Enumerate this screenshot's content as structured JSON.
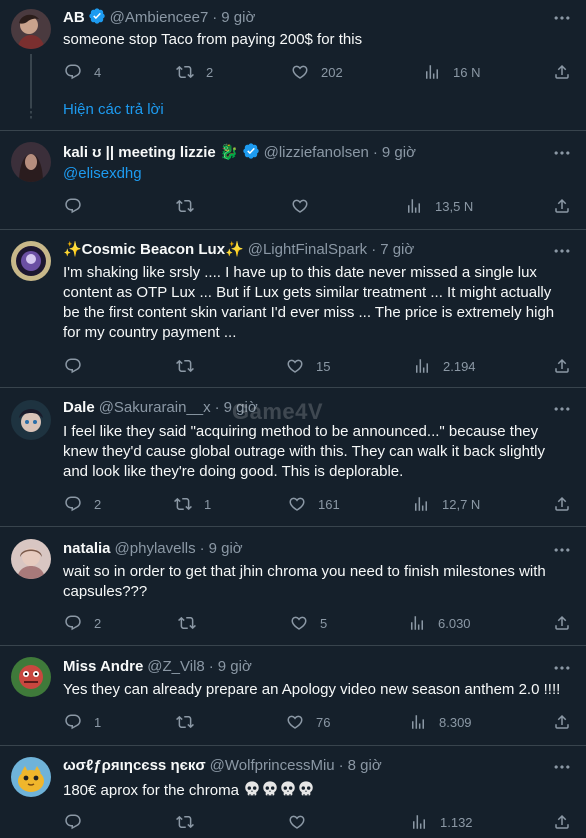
{
  "tweets": [
    {
      "name": "AB",
      "verified": true,
      "handle": "@Ambiencee7",
      "time": "9 giờ",
      "text": "someone stop Taco from paying 200$ for this",
      "replies": "4",
      "retweets": "2",
      "likes": "202",
      "views": "16 N",
      "show_replies": "Hiện các trả lời"
    },
    {
      "name": "kali ʊ || meeting lizzie 🐉",
      "verified": true,
      "handle": "@lizziefanolsen",
      "time": "9 giờ",
      "text": "@elisexdhg",
      "replies": "",
      "retweets": "",
      "likes": "",
      "views": "13,5 N"
    },
    {
      "name": "✨Cosmic Beacon Lux✨",
      "verified": false,
      "handle": "@LightFinalSpark",
      "time": "7 giờ",
      "text": "I'm shaking like srsly .... I have up to this date never missed a single lux content as OTP Lux ... But if Lux gets similar treatment ... It might actually be the first content skin variant I'd ever miss ... The price is extremely high for my country payment ...",
      "replies": "",
      "retweets": "",
      "likes": "15",
      "views": "2.194"
    },
    {
      "name": "Dale",
      "verified": false,
      "handle": "@Sakurarain__x",
      "time": "9 giờ",
      "text": "I feel like they said \"acquiring method to be announced...\" because they knew they'd cause global outrage with this. They can walk it back slightly and look like they're doing good. This is deplorable.",
      "replies": "2",
      "retweets": "1",
      "likes": "161",
      "views": "12,7 N",
      "watermark": "Game4V"
    },
    {
      "name": "natalia",
      "verified": false,
      "handle": "@phylavells",
      "time": "9 giờ",
      "text": "wait so in order to get that jhin chroma you need to finish milestones with capsules???",
      "replies": "2",
      "retweets": "",
      "likes": "5",
      "views": "6.030"
    },
    {
      "name": "Miss Andre",
      "verified": false,
      "handle": "@Z_Vil8",
      "time": "9 giờ",
      "text": "Yes they can already prepare an Apology video new season anthem 2.0 !!!!",
      "replies": "1",
      "retweets": "",
      "likes": "76",
      "views": "8.309"
    },
    {
      "name": "ωσℓƒρяιηcєѕѕ ηєкσ",
      "verified": false,
      "handle": "@WolfprincessMiu",
      "time": "8 giờ",
      "text": "180€ aprox for the chroma",
      "replies": "",
      "retweets": "",
      "likes": "",
      "views": "1.132"
    }
  ],
  "colors": {
    "background": "#15202b",
    "divider": "#38444d",
    "muted": "#8b98a5",
    "link": "#1d9bf0",
    "text": "#f7f9f9"
  },
  "icons": [
    "reply-icon",
    "retweet-icon",
    "like-icon",
    "views-icon",
    "share-icon",
    "more-icon",
    "verified-icon",
    "skull-icon"
  ]
}
